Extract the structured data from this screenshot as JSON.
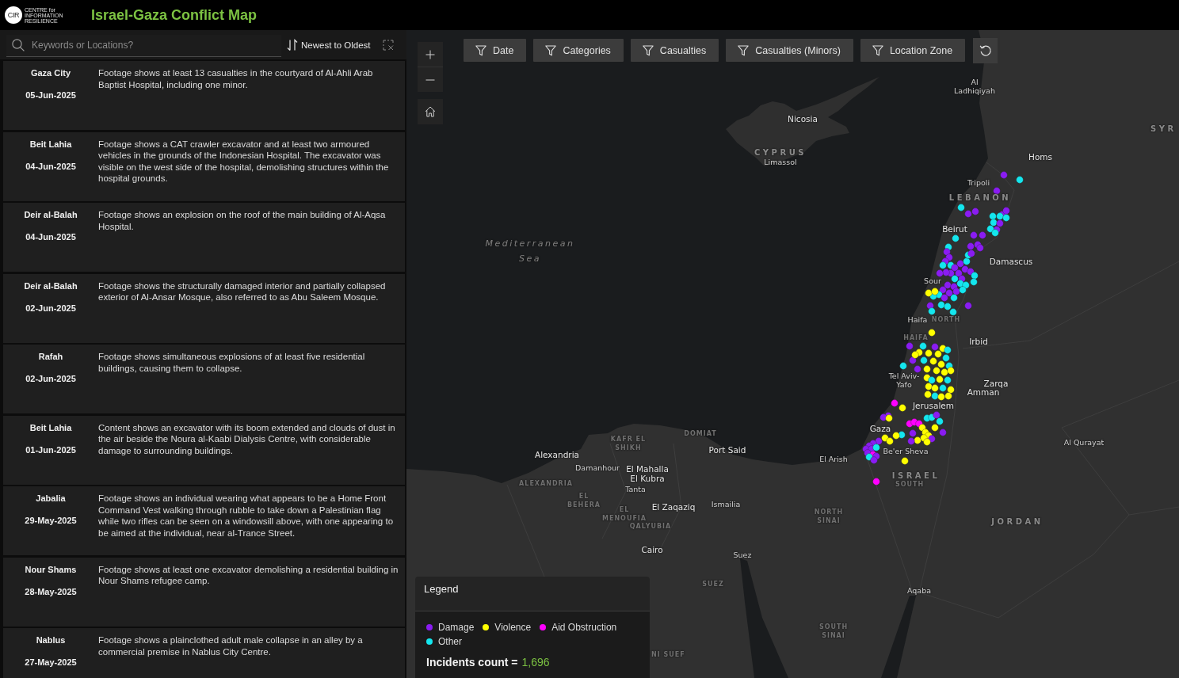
{
  "header": {
    "logo": {
      "mark": "CIR",
      "lines": [
        "CENTRE for",
        "INFORMATION",
        "RESILIENCE"
      ]
    },
    "title": "Israel-Gaza Conflict Map"
  },
  "sidebar": {
    "search": {
      "placeholder": "Keywords or Locations?"
    },
    "sort": {
      "label": "Newest to Oldest"
    },
    "incidents": [
      {
        "location": "Gaza City",
        "date": "05-Jun-2025",
        "description": "Footage shows at least 13 casualties in the courtyard of Al-Ahli Arab Baptist Hospital, including one minor."
      },
      {
        "location": "Beit Lahia",
        "date": "04-Jun-2025",
        "description": "Footage shows a CAT crawler excavator and at least two armoured vehicles in the grounds of the Indonesian Hospital. The excavator was visible on the west side of the hospital, demolishing structures within the hospital grounds."
      },
      {
        "location": "Deir al-Balah",
        "date": "04-Jun-2025",
        "description": "Footage shows an explosion on the roof of the main building of Al-Aqsa Hospital."
      },
      {
        "location": "Deir al-Balah",
        "date": "02-Jun-2025",
        "description": "Footage shows the structurally damaged interior and partially collapsed exterior of Al-Ansar Mosque, also referred to as Abu Saleem Mosque."
      },
      {
        "location": "Rafah",
        "date": "02-Jun-2025",
        "description": "Footage shows simultaneous explosions of at least five residential buildings, causing them to collapse."
      },
      {
        "location": "Beit Lahia",
        "date": "01-Jun-2025",
        "description": "Content shows an excavator with its boom extended and clouds of dust in the air beside the Noura al-Kaabi Dialysis Centre, with considerable damage to surrounding buildings."
      },
      {
        "location": "Jabalia",
        "date": "29-May-2025",
        "description": "Footage shows an individual wearing what appears to be a Home Front Command Vest walking through rubble to take down a Palestinian flag while two rifles can be seen on a windowsill above, with one appearing to be aimed at the individual, near al-Trance Street."
      },
      {
        "location": "Nour Shams",
        "date": "28-May-2025",
        "description": "Footage shows at least one excavator demolishing a residential building in Nour Shams refugee camp."
      },
      {
        "location": "Nablus",
        "date": "27-May-2025",
        "description": "Footage shows a plainclothed adult male collapse in an alley by a commercial premise in Nablus City Centre."
      }
    ]
  },
  "map": {
    "filters": [
      {
        "label": "Date"
      },
      {
        "label": "Categories"
      },
      {
        "label": "Casualties"
      },
      {
        "label": "Casualties (Minors)"
      },
      {
        "label": "Location Zone"
      }
    ],
    "labels": [
      {
        "text": "Nicosia",
        "kind": "city"
      },
      {
        "text": "CYPRUS",
        "kind": "country"
      },
      {
        "text": "Limassol",
        "kind": "town"
      },
      {
        "text": "Al Ladhiqiyah",
        "kind": "town"
      },
      {
        "text": "SYR",
        "kind": "country"
      },
      {
        "text": "Homs",
        "kind": "city"
      },
      {
        "text": "Tripoli",
        "kind": "town"
      },
      {
        "text": "LEBANON",
        "kind": "country"
      },
      {
        "text": "Beirut",
        "kind": "city"
      },
      {
        "text": "Damascus",
        "kind": "city"
      },
      {
        "text": "Mediterranean Sea",
        "kind": "sea"
      },
      {
        "text": "Sour",
        "kind": "town"
      },
      {
        "text": "Haifa",
        "kind": "town"
      },
      {
        "text": "NORTH",
        "kind": "region"
      },
      {
        "text": "HAIFA",
        "kind": "region"
      },
      {
        "text": "Irbid",
        "kind": "city"
      },
      {
        "text": "Tel Aviv-Yafo",
        "kind": "town"
      },
      {
        "text": "Zarqa",
        "kind": "city"
      },
      {
        "text": "Amman",
        "kind": "city"
      },
      {
        "text": "Jerusalem",
        "kind": "city"
      },
      {
        "text": "Gaza",
        "kind": "city"
      },
      {
        "text": "Be'er Sheva",
        "kind": "town"
      },
      {
        "text": "El Arish",
        "kind": "town"
      },
      {
        "text": "ISRAEL",
        "kind": "country"
      },
      {
        "text": "SOUTH",
        "kind": "region"
      },
      {
        "text": "Al Qurayat",
        "kind": "town"
      },
      {
        "text": "DOMIAT",
        "kind": "region"
      },
      {
        "text": "KAFR EL SHIKH",
        "kind": "region"
      },
      {
        "text": "Port Said",
        "kind": "city"
      },
      {
        "text": "Alexandria",
        "kind": "city"
      },
      {
        "text": "Damanhour",
        "kind": "town"
      },
      {
        "text": "El Mahalla El Kubra",
        "kind": "city"
      },
      {
        "text": "Tanta",
        "kind": "town"
      },
      {
        "text": "ALEXANDRIA",
        "kind": "region"
      },
      {
        "text": "EL BEHERA",
        "kind": "region"
      },
      {
        "text": "El Zaqaziq",
        "kind": "city"
      },
      {
        "text": "Ismailia",
        "kind": "town"
      },
      {
        "text": "EL MENOUFIA",
        "kind": "region"
      },
      {
        "text": "QALYUBIA",
        "kind": "region"
      },
      {
        "text": "Cairo",
        "kind": "city"
      },
      {
        "text": "Suez",
        "kind": "town"
      },
      {
        "text": "SUEZ",
        "kind": "region"
      },
      {
        "text": "NORTH SINAI",
        "kind": "region"
      },
      {
        "text": "JORDAN",
        "kind": "country"
      },
      {
        "text": "Aqaba",
        "kind": "town"
      },
      {
        "text": "SOUTH SINAI",
        "kind": "region"
      },
      {
        "text": "NI SUEF",
        "kind": "region"
      }
    ]
  },
  "legend": {
    "title": "Legend",
    "items": [
      {
        "label": "Damage",
        "color": "#8a1cf2"
      },
      {
        "label": "Violence",
        "color": "#ffff00"
      },
      {
        "label": "Aid Obstruction",
        "color": "#ff00ff"
      },
      {
        "label": "Other",
        "color": "#14e6ee"
      }
    ],
    "count_label": "Incidents count =",
    "count_value": "1,696"
  }
}
